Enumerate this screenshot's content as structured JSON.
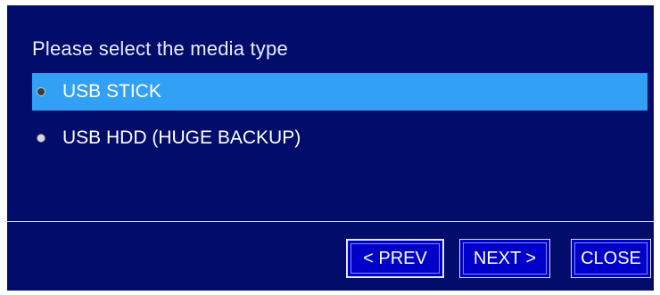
{
  "dialog": {
    "prompt": "Please select the media type",
    "options": [
      {
        "label": "USB STICK",
        "selected": true
      },
      {
        "label": "USB HDD (HUGE BACKUP)",
        "selected": false
      }
    ]
  },
  "buttons": {
    "prev_label": "< PREV",
    "next_label": "NEXT >",
    "close_label": "CLOSE"
  },
  "colors": {
    "dialog_background": "#020c6b",
    "selection_highlight": "#32a0f5",
    "button_background": "#0000c8"
  }
}
